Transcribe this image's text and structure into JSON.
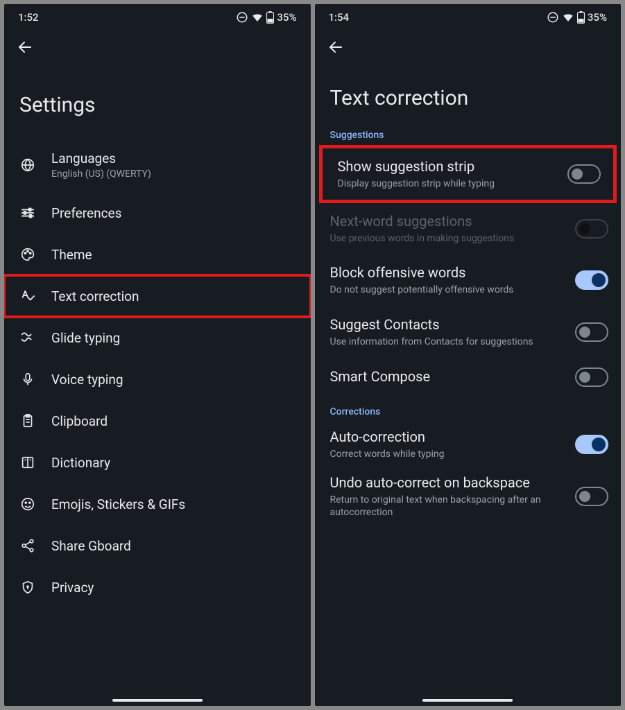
{
  "left": {
    "status_time": "1:52",
    "battery": "35%",
    "title": "Settings",
    "items": [
      {
        "title": "Languages",
        "sub": "English (US) (QWERTY)"
      },
      {
        "title": "Preferences"
      },
      {
        "title": "Theme"
      },
      {
        "title": "Text correction"
      },
      {
        "title": "Glide typing"
      },
      {
        "title": "Voice typing"
      },
      {
        "title": "Clipboard"
      },
      {
        "title": "Dictionary"
      },
      {
        "title": "Emojis, Stickers & GIFs"
      },
      {
        "title": "Share Gboard"
      },
      {
        "title": "Privacy"
      }
    ]
  },
  "right": {
    "status_time": "1:54",
    "battery": "35%",
    "title": "Text correction",
    "section1": "Suggestions",
    "section2": "Corrections",
    "toggles": [
      {
        "title": "Show suggestion strip",
        "sub": "Display suggestion strip while typing"
      },
      {
        "title": "Next-word suggestions",
        "sub": "Use previous words in making suggestions"
      },
      {
        "title": "Block offensive words",
        "sub": "Do not suggest potentially offensive words"
      },
      {
        "title": "Suggest Contacts",
        "sub": "Use information from Contacts for suggestions"
      },
      {
        "title": "Smart Compose"
      },
      {
        "title": "Auto-correction",
        "sub": "Correct words while typing"
      },
      {
        "title": "Undo auto-correct on backspace",
        "sub": "Return to original text when backspacing after an autocorrection"
      }
    ]
  }
}
